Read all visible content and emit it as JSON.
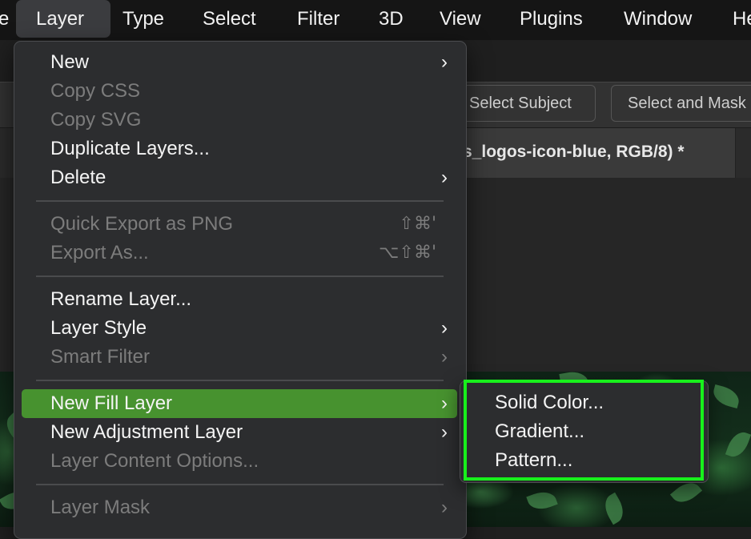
{
  "menubar": {
    "items": [
      {
        "label": "e"
      },
      {
        "label": "Layer"
      },
      {
        "label": "Type"
      },
      {
        "label": "Select"
      },
      {
        "label": "Filter"
      },
      {
        "label": "3D"
      },
      {
        "label": "View"
      },
      {
        "label": "Plugins"
      },
      {
        "label": "Window"
      },
      {
        "label": "He"
      }
    ]
  },
  "options_bar": {
    "select_subject": "Select Subject",
    "select_and_mask": "Select and Mask"
  },
  "document": {
    "tab_title": "s_logos-icon-blue, RGB/8) *"
  },
  "layer_menu": {
    "items": [
      {
        "label": "New",
        "submenu": true,
        "enabled": true
      },
      {
        "label": "Copy CSS",
        "enabled": false
      },
      {
        "label": "Copy SVG",
        "enabled": false
      },
      {
        "label": "Duplicate Layers...",
        "enabled": true
      },
      {
        "label": "Delete",
        "submenu": true,
        "enabled": true
      },
      {
        "label": "Quick Export as PNG",
        "shortcut": "⇧⌘'",
        "enabled": false
      },
      {
        "label": "Export As...",
        "shortcut": "⌥⇧⌘'",
        "enabled": false
      },
      {
        "label": "Rename Layer...",
        "enabled": true
      },
      {
        "label": "Layer Style",
        "submenu": true,
        "enabled": true
      },
      {
        "label": "Smart Filter",
        "submenu": true,
        "enabled": false
      },
      {
        "label": "New Fill Layer",
        "submenu": true,
        "enabled": true,
        "highlighted": true
      },
      {
        "label": "New Adjustment Layer",
        "submenu": true,
        "enabled": true
      },
      {
        "label": "Layer Content Options...",
        "enabled": false
      },
      {
        "label": "Layer Mask",
        "submenu": true,
        "enabled": false
      }
    ],
    "chevron": "›"
  },
  "fill_submenu": {
    "items": [
      {
        "label": "Solid Color..."
      },
      {
        "label": "Gradient..."
      },
      {
        "label": "Pattern..."
      }
    ],
    "outline_color": "#18f01c"
  },
  "colors": {
    "highlight": "#47922f",
    "menu_bg": "#2c2d2f"
  }
}
